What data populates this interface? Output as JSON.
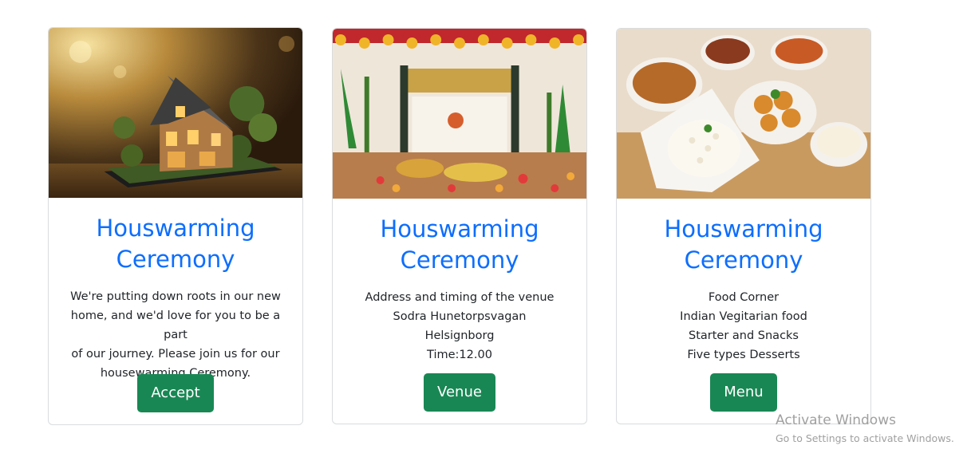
{
  "cards": [
    {
      "image": "house-model-photo",
      "title": "Houswarming Ceremony",
      "text_lines": [
        "We're putting down roots in our new",
        "home, and we'd love for you to be a part",
        "of our journey. Please join us for our",
        "housewarming Ceremony."
      ],
      "button_label": "Accept"
    },
    {
      "image": "ceremony-decoration-photo",
      "title": "Houswarming Ceremony",
      "text_lines": [
        "Address and timing of the venue",
        "Sodra Hunetorpsvagan",
        "Helsignborg",
        "Time:12.00"
      ],
      "button_label": "Venue"
    },
    {
      "image": "indian-food-platter-photo",
      "title": "Houswarming Ceremony",
      "text_lines": [
        "Food Corner",
        "Indian Vegitarian food",
        "Starter and Snacks",
        "Five types Desserts"
      ],
      "button_label": "Menu"
    }
  ],
  "watermark": {
    "title": "Activate Windows",
    "subtitle": "Go to Settings to activate Windows."
  },
  "colors": {
    "title": "#0d6efd",
    "button": "#198754",
    "border": "#d9dcdf"
  }
}
